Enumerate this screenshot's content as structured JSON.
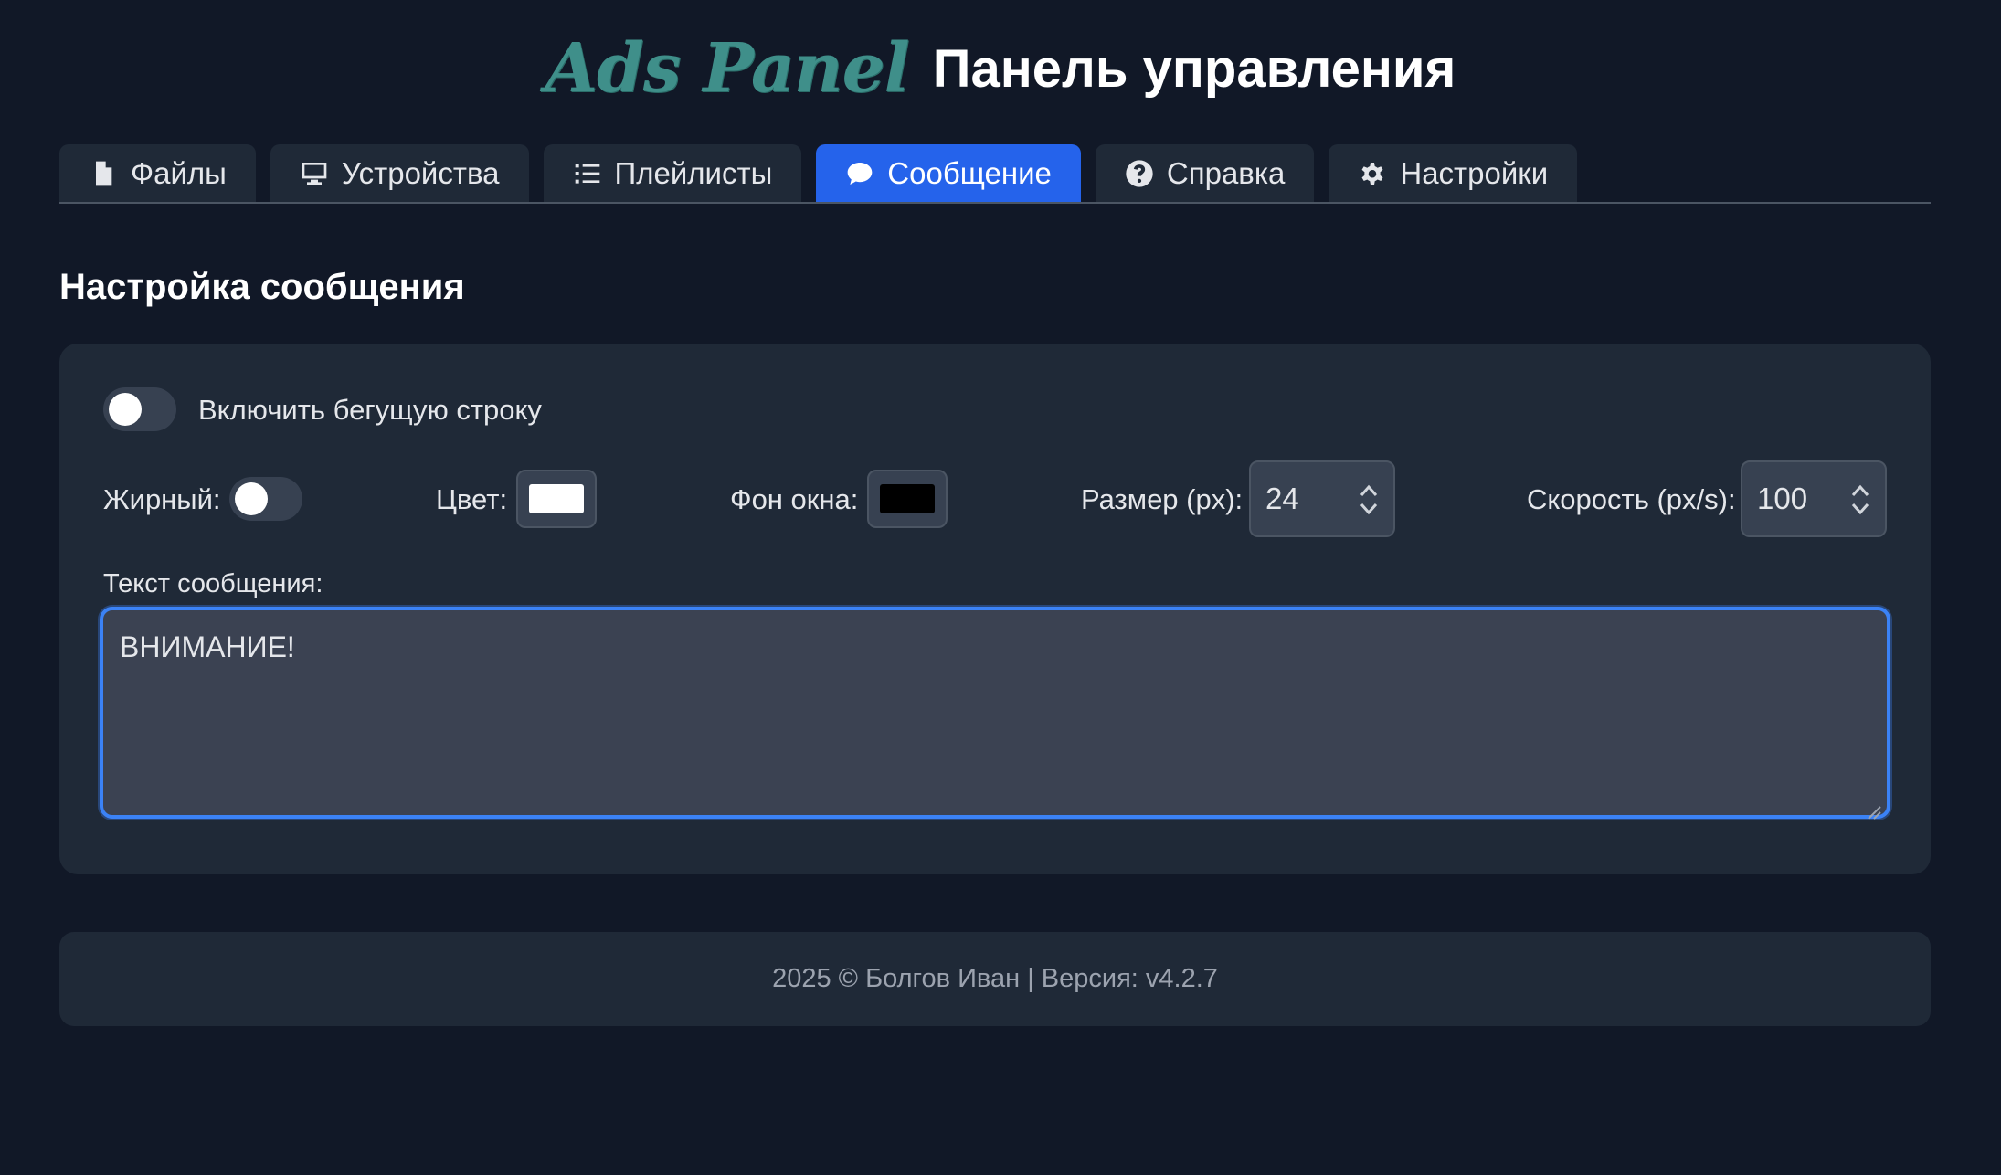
{
  "header": {
    "logo": "Ads Panel",
    "title": "Панель управления"
  },
  "tabs": [
    {
      "label": "Файлы",
      "icon": "file-icon"
    },
    {
      "label": "Устройства",
      "icon": "monitor-icon"
    },
    {
      "label": "Плейлисты",
      "icon": "list-icon"
    },
    {
      "label": "Сообщение",
      "icon": "chat-icon",
      "active": true
    },
    {
      "label": "Справка",
      "icon": "question-circle-icon"
    },
    {
      "label": "Настройки",
      "icon": "gear-icon"
    }
  ],
  "section": {
    "title": "Настройка сообщения"
  },
  "settings": {
    "ticker_label": "Включить бегущую строку",
    "ticker_enabled": false,
    "bold_label": "Жирный:",
    "bold_enabled": false,
    "color_label": "Цвет:",
    "color_value": "#ffffff",
    "bg_label": "Фон окна:",
    "bg_value": "#000000",
    "size_label": "Размер (px):",
    "size_value": "24",
    "speed_label": "Скорость (px/s):",
    "speed_value": "100",
    "text_label": "Текст сообщения:",
    "text_value": "ВНИМАНИЕ!"
  },
  "footer": {
    "text": "2025 © Болгов Иван | Версия: v4.2.7"
  },
  "colors": {
    "background": "#111827",
    "panel": "#1f2937",
    "accent": "#2563eb",
    "logo": "#3f8f8a"
  }
}
